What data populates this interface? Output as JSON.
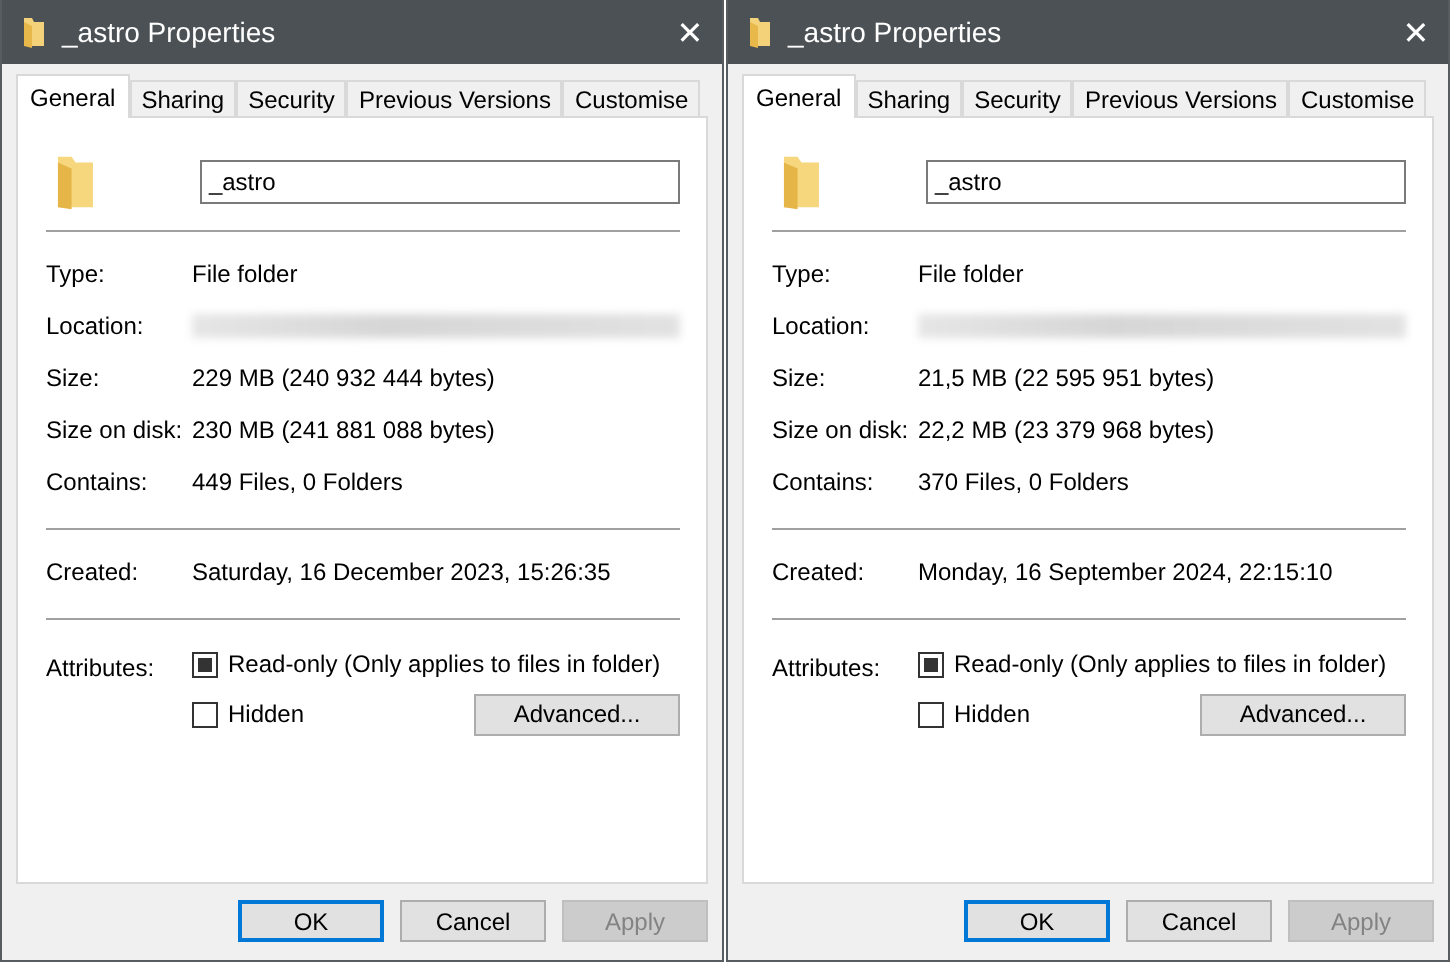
{
  "windows": [
    {
      "title": "_astro Properties",
      "close": "✕",
      "tabs": [
        {
          "label": "General",
          "selected": true
        },
        {
          "label": "Sharing",
          "selected": false
        },
        {
          "label": "Security",
          "selected": false
        },
        {
          "label": "Previous Versions",
          "selected": false
        },
        {
          "label": "Customise",
          "selected": false
        }
      ],
      "name": "_astro",
      "sections": [
        [
          {
            "label": "Type:",
            "kind": "text",
            "value": "File folder"
          },
          {
            "label": "Location:",
            "kind": "redacted"
          },
          {
            "label": "Size:",
            "kind": "text",
            "value": "229 MB (240 932 444 bytes)"
          },
          {
            "label": "Size on disk:",
            "kind": "text",
            "value": "230 MB (241 881 088 bytes)"
          },
          {
            "label": "Contains:",
            "kind": "text",
            "value": "449 Files, 0 Folders"
          }
        ],
        [
          {
            "label": "Created:",
            "kind": "text",
            "value": "Saturday, 16 December 2023, 15:26:35"
          }
        ]
      ],
      "attributes": {
        "label": "Attributes:",
        "checkboxes": [
          {
            "label": "Read-only (Only applies to files in folder)",
            "checked": true
          },
          {
            "label": "Hidden",
            "checked": false
          }
        ],
        "advanced": "Advanced..."
      },
      "buttons": [
        {
          "label": "OK",
          "default": true,
          "disabled": false
        },
        {
          "label": "Cancel",
          "default": false,
          "disabled": false
        },
        {
          "label": "Apply",
          "default": false,
          "disabled": true
        }
      ]
    },
    {
      "title": "_astro Properties",
      "close": "✕",
      "tabs": [
        {
          "label": "General",
          "selected": true
        },
        {
          "label": "Sharing",
          "selected": false
        },
        {
          "label": "Security",
          "selected": false
        },
        {
          "label": "Previous Versions",
          "selected": false
        },
        {
          "label": "Customise",
          "selected": false
        }
      ],
      "name": "_astro",
      "sections": [
        [
          {
            "label": "Type:",
            "kind": "text",
            "value": "File folder"
          },
          {
            "label": "Location:",
            "kind": "redacted"
          },
          {
            "label": "Size:",
            "kind": "text",
            "value": "21,5 MB (22 595 951 bytes)"
          },
          {
            "label": "Size on disk:",
            "kind": "text",
            "value": "22,2 MB (23 379 968 bytes)"
          },
          {
            "label": "Contains:",
            "kind": "text",
            "value": "370 Files, 0 Folders"
          }
        ],
        [
          {
            "label": "Created:",
            "kind": "text",
            "value": "Monday, 16 September 2024, 22:15:10"
          }
        ]
      ],
      "attributes": {
        "label": "Attributes:",
        "checkboxes": [
          {
            "label": "Read-only (Only applies to files in folder)",
            "checked": true
          },
          {
            "label": "Hidden",
            "checked": false
          }
        ],
        "advanced": "Advanced..."
      },
      "buttons": [
        {
          "label": "OK",
          "default": true,
          "disabled": false
        },
        {
          "label": "Cancel",
          "default": false,
          "disabled": false
        },
        {
          "label": "Apply",
          "default": false,
          "disabled": true
        }
      ]
    }
  ]
}
